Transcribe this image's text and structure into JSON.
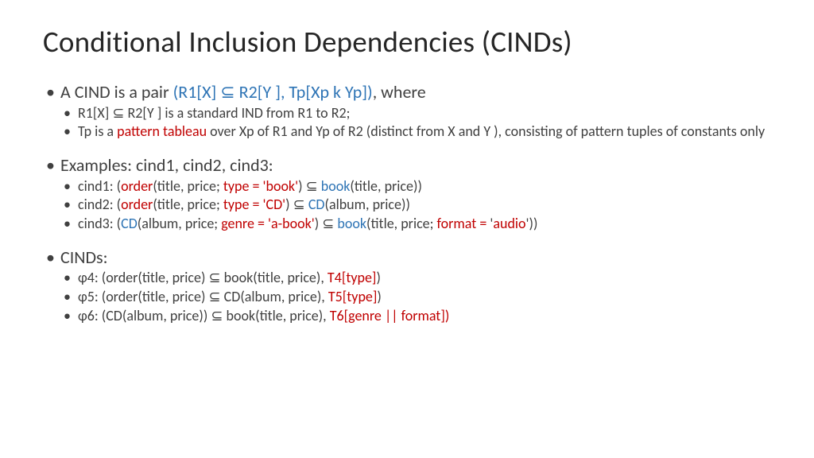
{
  "title": "Conditional Inclusion Dependencies (CINDs)",
  "b1": {
    "lead": "A CIND is a pair ",
    "pair": "(R1[X] ⊆ R2[Y ], Tp[Xp k Yp])",
    "tail": ", where",
    "sub1": "R1[X] ⊆ R2[Y ] is a standard IND from R1 to R2;",
    "sub2a": "Tp is a ",
    "sub2b": "pattern tableau",
    "sub2c": " over Xp of R1 and Yp of R2 (distinct from X and Y ), consisting of pattern tuples of constants only"
  },
  "b2": {
    "head": "Examples: cind1, cind2, cind3:",
    "c1": {
      "a": "cind1: (",
      "b": "order",
      "c": "(title, price; ",
      "d": "type = 'book'",
      "e": ") ⊆ ",
      "f": "book",
      "g": "(title, price))"
    },
    "c2": {
      "a": "cind2: (",
      "b": "order",
      "c": "(title, price; ",
      "d": "type = 'CD'",
      "e": ") ⊆ ",
      "f": "CD",
      "g": "(album, price))"
    },
    "c3": {
      "a": "cind3: (",
      "b": "CD",
      "c": "(album, price; ",
      "d": "genre = 'a-book'",
      "e": ") ⊆ ",
      "f": "book",
      "g": "(title, price; ",
      "h": "format = ",
      "i": "'",
      "j": "audio",
      "k": "'",
      "l": "))"
    }
  },
  "b3": {
    "head": "CINDs:",
    "p4": {
      "a": "φ4: (order(title, price) ⊆ book(title, price), ",
      "b": "T4[type]",
      "c": ")"
    },
    "p5": {
      "a": "φ5: (order(title, price) ⊆ CD(album, price), ",
      "b": "T5[type]",
      "c": ")"
    },
    "p6": {
      "a": "φ6: (CD(album, price)) ⊆ book(title, price), ",
      "b": "T6[genre || format])"
    }
  }
}
